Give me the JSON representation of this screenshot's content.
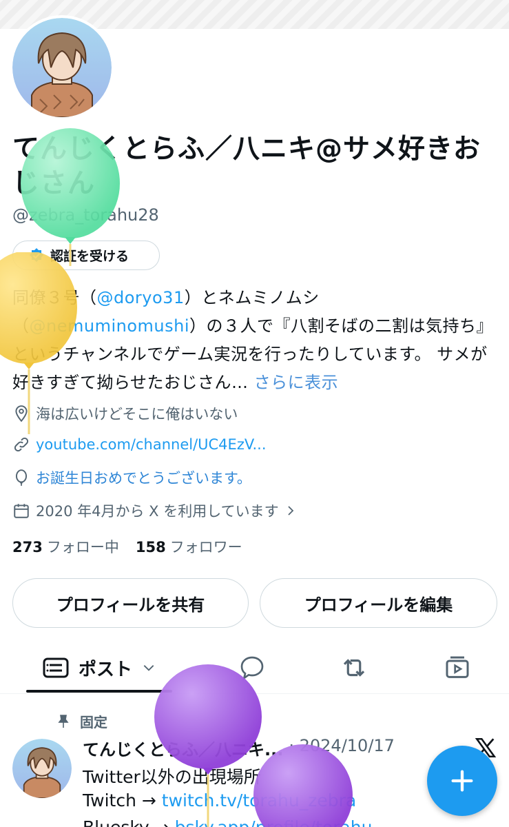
{
  "profile": {
    "display_name": "てんじくとらふ／八ニキ@サメ好きおじさん",
    "handle": "@zebra_torahu28",
    "verify_label": "認証を受ける",
    "bio": {
      "part1": "同僚３号（",
      "mention1": "@doryo31",
      "part2": "）とネムミノムシ（",
      "mention2": "@nemuminomushi",
      "part3": "）の３人で『八割そばの二割は気持ち』というチャンネルでゲーム実況を行ったりしています。 サメが好きすぎて拗らせたおじさん…",
      "more": "さらに表示"
    },
    "location": "海は広いけどそこに俺はいない",
    "link": "youtube.com/channel/UC4EzV...",
    "birthday": "お誕生日おめでとうございます。",
    "joined": "2020 年4月から X を利用しています"
  },
  "stats": {
    "following_count": "273",
    "following_label": "フォロー中",
    "followers_count": "158",
    "followers_label": "フォロワー"
  },
  "buttons": {
    "share": "プロフィールを共有",
    "edit": "プロフィールを編集"
  },
  "tabs": {
    "posts_label": "ポスト"
  },
  "post": {
    "pinned_label": "固定",
    "author": "てんじくとらふ／八ニキ...",
    "date": "· 2024/10/17",
    "line1": "Twitter以外の出現場所",
    "line2_prefix": "Twitch → ",
    "line2_link": "twitch.tv/torahu_zebra",
    "line3_prefix": "Bluesky → ",
    "line3_link": "bsky.app/profile/torahu..."
  },
  "colors": {
    "accent": "#1d9bf0",
    "text": "#0f1419",
    "secondary": "#536471",
    "balloon_green": "#6fe8b0",
    "balloon_yellow": "#f6d14e",
    "balloon_purple": "#9b4fe0"
  }
}
